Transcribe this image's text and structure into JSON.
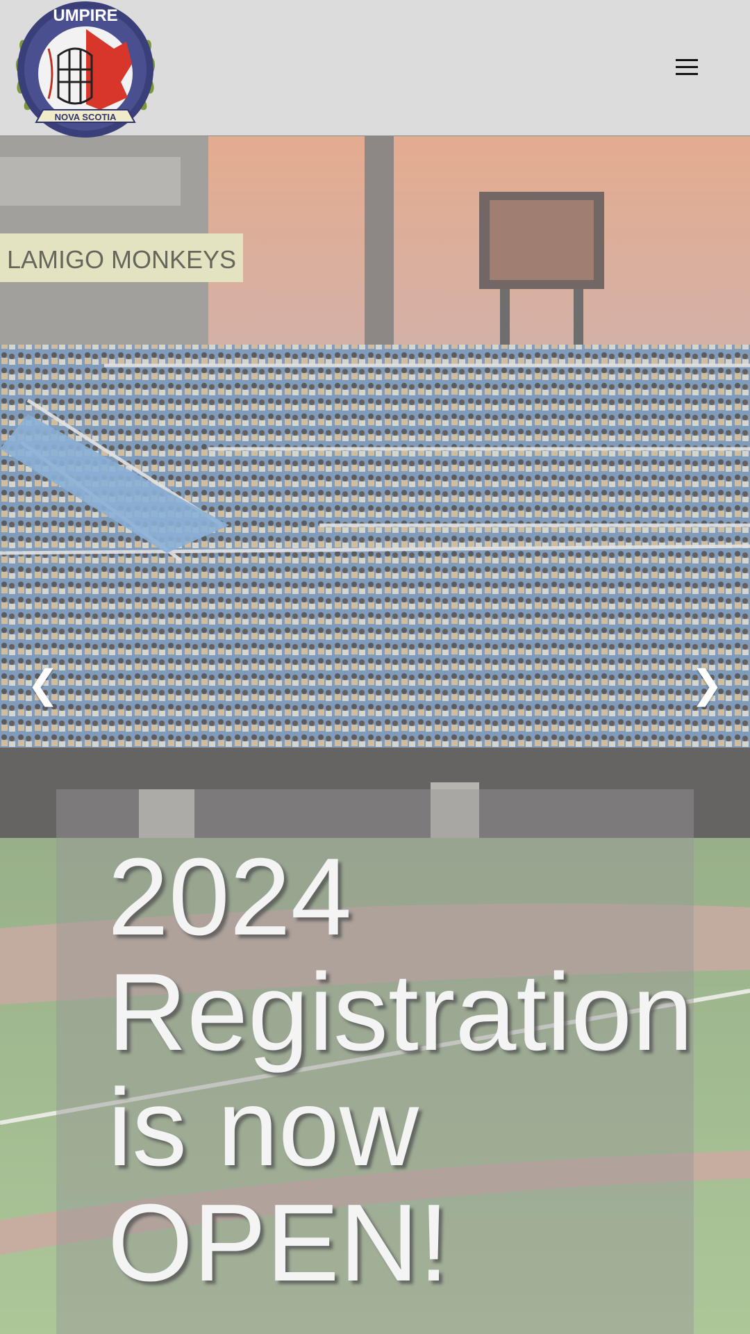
{
  "header": {
    "logo": {
      "alt": "Umpire Nova Scotia logo",
      "top_text": "UMPIRE",
      "banner_text": "NOVA SCOTIA",
      "icon": "umpire-logo"
    },
    "menu_icon": "hamburger-menu-icon"
  },
  "hero": {
    "slide": {
      "image_description_icon": "baseball-stadium-photo",
      "stadium_sign": "LAMIGO MONKEYS",
      "caption": "2024\nRegistration\nis now\nOPEN!"
    },
    "prev_arrow": "❮",
    "next_arrow": "❯"
  },
  "colors": {
    "header_bg": "#dcdcdc",
    "caption_text": "#f4f4f4"
  }
}
